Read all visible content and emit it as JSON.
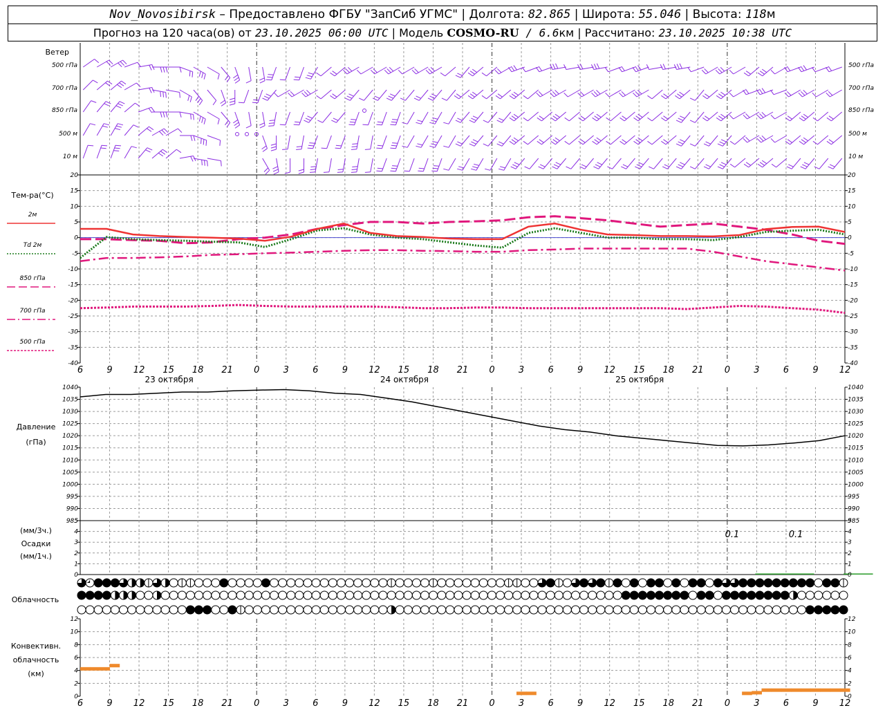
{
  "header": {
    "station": "Nov_Novosibirsk",
    "provider": " – Предоставлено ФГБУ \"ЗапСиб УГМС\" | Долгота: ",
    "lon": "82.865",
    "lat_label": " | Широта: ",
    "lat": "55.046",
    "alt_label": " | Высота: ",
    "alt": "118",
    "alt_unit": "м",
    "forecast_label": "Прогноз на 120 часа(ов) от ",
    "forecast_from": "23.10.2025 06:00 UTC",
    "model_label": "  | Модель ",
    "model": "COSMO-RU",
    "model_res": " / 6.6",
    "model_res_unit": "км",
    "calc_label": " | Рассчитано: ",
    "calc_time": "23.10.2025 10:38 UTC"
  },
  "colors": {
    "wind": "#8a2be2",
    "t2m": "#ee3333",
    "td2m": "#1a7a1a",
    "t850": "#e0177c",
    "t700": "#e0177c",
    "t500": "#e0177c",
    "pressure": "#000000",
    "precip": "#2e9e2e",
    "convective": "#ef8a2c",
    "grid": "#9a9a9a"
  },
  "wind_panel": {
    "title": "Ветер",
    "levels": [
      "500 гПа",
      "700 гПа",
      "850 гПа",
      "500 м",
      "10  м"
    ]
  },
  "temp_panel": {
    "title": "Тем-ра(°C)",
    "legend": [
      {
        "label": "2м",
        "style": "solid",
        "color_key": "t2m"
      },
      {
        "label": "Td  2м",
        "style": "dotted",
        "color_key": "td2m"
      },
      {
        "label": "850 гПа",
        "style": "dash",
        "color_key": "t850"
      },
      {
        "label": "700 гПа",
        "style": "dashdot",
        "color_key": "t700"
      },
      {
        "label": "500 гПа",
        "style": "shortdash",
        "color_key": "t500"
      }
    ]
  },
  "pressure_panel": {
    "title": "Давление",
    "unit": "(гПа)"
  },
  "precip_panel": {
    "unit_top": "(мм/3ч.)",
    "title": "Осадки",
    "unit_bottom": "(мм/1ч.)",
    "annotations": [
      "0.1",
      "0.1"
    ]
  },
  "cloud_panel": {
    "title": "Облачность"
  },
  "conv_panel": {
    "title1": "Конвективн.",
    "title2": "облачность",
    "unit": "(км)"
  },
  "x_axis": {
    "hour_labels": [
      "6",
      "9",
      "12",
      "15",
      "18",
      "21",
      "0",
      "3",
      "6",
      "9",
      "12",
      "15",
      "18",
      "21",
      "0",
      "3",
      "6",
      "9",
      "12",
      "15",
      "18",
      "21",
      "0",
      "3",
      "6",
      "9",
      "12"
    ],
    "dates": [
      "23 октября",
      "24 октября",
      "25 октября"
    ]
  },
  "chart_data": [
    {
      "type": "line",
      "panel": "temperature",
      "x_hours": [
        0,
        3,
        6,
        9,
        12,
        15,
        18,
        21,
        24,
        27,
        30,
        33,
        36,
        39,
        42,
        45,
        48,
        51,
        54,
        57,
        60,
        63,
        66,
        69,
        72,
        75,
        78
      ],
      "ylim": [
        -40,
        20
      ],
      "yticks": [
        -40,
        -35,
        -30,
        -25,
        -20,
        -15,
        -10,
        -5,
        0,
        5,
        10,
        15,
        20
      ],
      "series": [
        {
          "name": "2м",
          "values": [
            2.8,
            2.8,
            1.0,
            0.5,
            0.2,
            0.0,
            -0.3,
            -1.0,
            0.3,
            2.8,
            4.5,
            1.5,
            0.5,
            0.2,
            -0.3,
            -0.5,
            -0.5,
            3.5,
            4.5,
            2.5,
            1.0,
            0.8,
            0.5,
            0.5,
            0.4,
            0.8,
            2.7,
            3.4,
            3.5,
            1.8
          ]
        },
        {
          "name": "Td  2м",
          "values": [
            -6.5,
            0.2,
            -0.5,
            -0.8,
            -1.0,
            -1.3,
            -1.5,
            -3.0,
            -0.5,
            2.3,
            3.0,
            1.0,
            0.0,
            -0.5,
            -1.5,
            -2.5,
            -3.2,
            1.5,
            3.0,
            1.5,
            0.0,
            0.0,
            -0.5,
            -0.5,
            -0.8,
            0.2,
            1.8,
            2.2,
            2.5,
            1.0
          ]
        },
        {
          "name": "850 гПа",
          "values": [
            -0.5,
            -0.5,
            -0.8,
            -1.0,
            -1.8,
            -1.5,
            -0.5,
            0.0,
            1.0,
            2.8,
            4.0,
            5.0,
            5.0,
            4.5,
            5.0,
            5.2,
            5.5,
            6.5,
            6.8,
            6.2,
            5.5,
            4.5,
            3.5,
            4.0,
            4.5,
            3.5,
            2.5,
            1.0,
            -1.0,
            -2.0
          ]
        },
        {
          "name": "700 гПа",
          "values": [
            -7.5,
            -6.5,
            -6.5,
            -6.3,
            -6.0,
            -5.5,
            -5.3,
            -5.0,
            -4.8,
            -4.5,
            -4.2,
            -4.0,
            -4.0,
            -4.2,
            -4.3,
            -4.5,
            -4.5,
            -4.0,
            -3.8,
            -3.5,
            -3.5,
            -3.5,
            -3.5,
            -3.5,
            -4.5,
            -6.0,
            -7.5,
            -8.5,
            -9.5,
            -10.5
          ]
        },
        {
          "name": "500 гПа",
          "values": [
            -22.5,
            -22.3,
            -22.0,
            -22.0,
            -22.0,
            -21.8,
            -21.5,
            -21.8,
            -22.0,
            -22.0,
            -22.0,
            -22.0,
            -22.2,
            -22.5,
            -22.5,
            -22.3,
            -22.3,
            -22.5,
            -22.5,
            -22.5,
            -22.5,
            -22.5,
            -22.5,
            -22.8,
            -22.3,
            -21.8,
            -22.0,
            -22.5,
            -23.0,
            -24.0
          ]
        }
      ]
    },
    {
      "type": "line",
      "panel": "pressure",
      "ylim": [
        985,
        1040
      ],
      "yticks": [
        985,
        990,
        995,
        1000,
        1005,
        1010,
        1015,
        1020,
        1025,
        1030,
        1035,
        1040
      ],
      "series": [
        {
          "name": "Давление",
          "values": [
            1036,
            1037,
            1037,
            1037.5,
            1038,
            1038,
            1038.5,
            1038.8,
            1039,
            1038.5,
            1037.5,
            1037,
            1035.5,
            1034,
            1032,
            1030,
            1028,
            1026,
            1024,
            1022.5,
            1021.5,
            1020,
            1019,
            1018,
            1017,
            1016,
            1015.8,
            1016.2,
            1017,
            1018,
            1020
          ]
        }
      ]
    },
    {
      "type": "bar",
      "panel": "precipitation",
      "ylim": [
        0,
        5
      ],
      "yticks": [
        0,
        1,
        2,
        3,
        4,
        5
      ],
      "series": [
        {
          "name": "Осадки",
          "x_hours": [
            69,
            72,
            78
          ],
          "values": [
            0.1,
            0.1,
            0.1
          ]
        }
      ]
    },
    {
      "type": "bar",
      "panel": "convective_cloud",
      "ylim": [
        0,
        12
      ],
      "yticks": [
        0,
        2,
        4,
        6,
        8,
        10,
        12
      ],
      "series": [
        {
          "name": "Конвективн. облачность",
          "x_hours": [
            0.5,
            1.5,
            2.5,
            3.5
          ],
          "values": [
            4.3,
            4.3,
            4.3,
            4.8
          ]
        },
        {
          "name": "Конвективн. облачность",
          "x_hours": [
            45,
            46
          ],
          "values": [
            0.5,
            0.5
          ]
        },
        {
          "name": "Конвективн. облачность",
          "x_hours": [
            68,
            69,
            70,
            71,
            72,
            73,
            74,
            75,
            76,
            77,
            78
          ],
          "values": [
            0.5,
            0.6,
            1.0,
            1.0,
            1.0,
            1.0,
            1.0,
            1.0,
            1.0,
            1.0,
            1.0
          ]
        }
      ]
    }
  ],
  "cloud_cover": {
    "rows": [
      "35444322132011000400004000000000000001000010000000011003410343414040440404404334444444440441",
      "44442220020000000000000000000000000000000000000000000000000000000444444440440444444442000000",
      "00000000000004440041000000000000000002000000000000000000000000000000000000000000000000044444"
    ]
  }
}
